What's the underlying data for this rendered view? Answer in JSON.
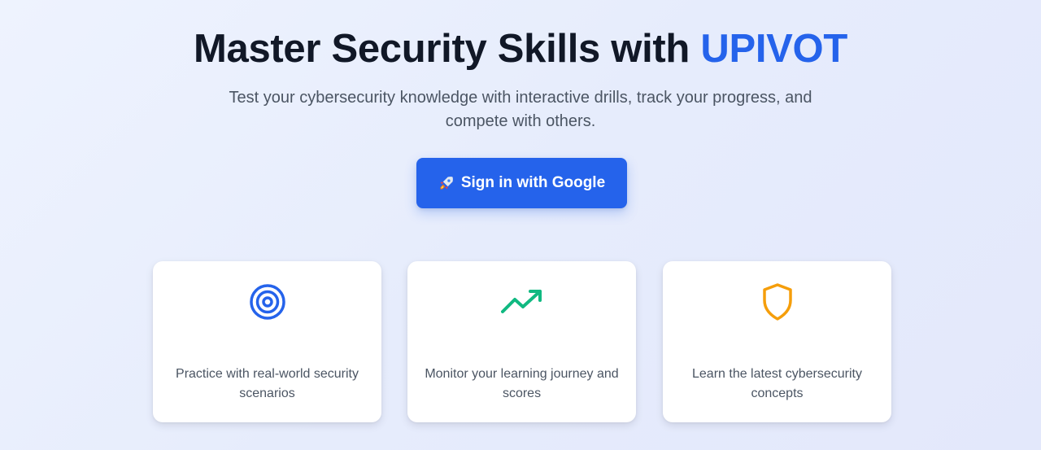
{
  "hero": {
    "title_prefix": "Master Security Skills with ",
    "title_brand": "UPIVOT",
    "subtitle": "Test your cybersecurity knowledge with interactive drills, track your progress, and compete with others.",
    "cta_label": "Sign in with Google",
    "cta_icon": "rocket-icon"
  },
  "features": [
    {
      "icon": "target-icon",
      "icon_color": "#2563eb",
      "description": "Practice with real-world security scenarios"
    },
    {
      "icon": "trending-up-icon",
      "icon_color": "#10b981",
      "description": "Monitor your learning journey and scores"
    },
    {
      "icon": "shield-icon",
      "icon_color": "#f59e0b",
      "description": "Learn the latest cybersecurity concepts"
    }
  ],
  "colors": {
    "brand": "#2563eb",
    "heading": "#111827",
    "body_text": "#4b5563"
  }
}
